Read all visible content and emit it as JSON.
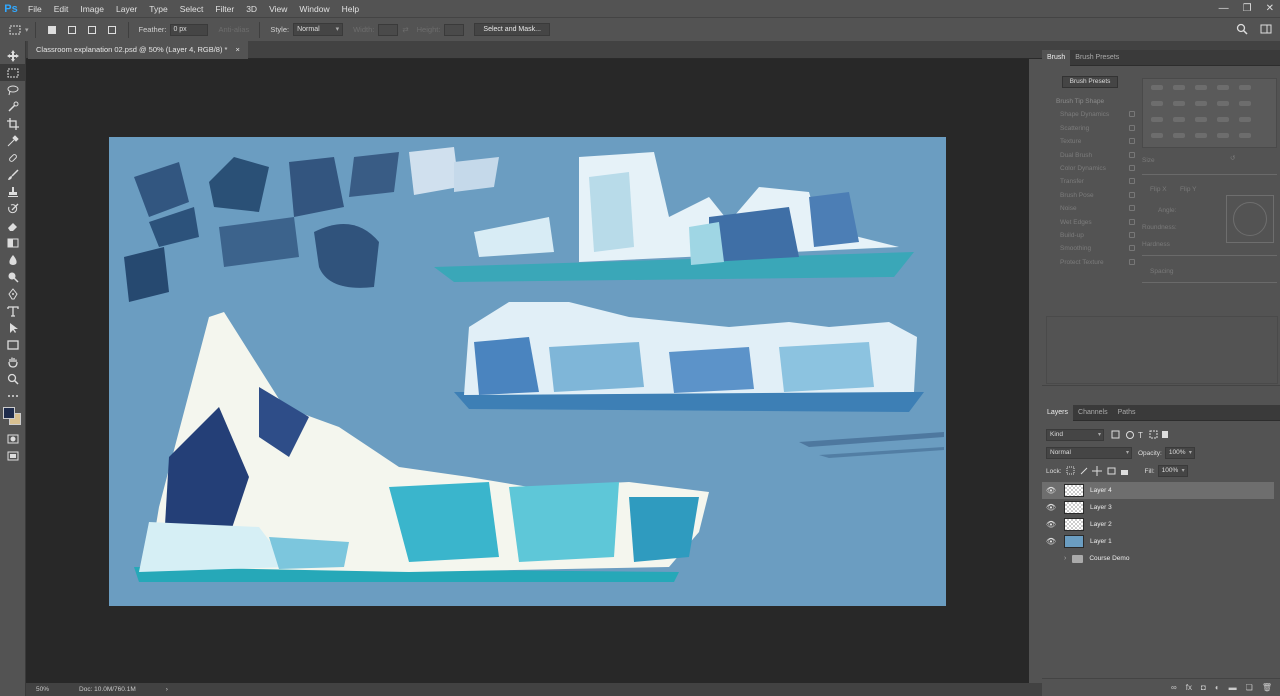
{
  "app": {
    "logo": "Ps"
  },
  "menu": [
    "File",
    "Edit",
    "Image",
    "Layer",
    "Type",
    "Select",
    "Filter",
    "3D",
    "View",
    "Window",
    "Help"
  ],
  "window_controls": {
    "minimize": "—",
    "restore": "❐",
    "close": "✕"
  },
  "options": {
    "feather_label": "Feather:",
    "feather_value": "0 px",
    "antialias_label": "Anti-alias",
    "style_label": "Style:",
    "style_value": "Normal",
    "width_label": "Width:",
    "height_label": "Height:",
    "select_mask_label": "Select and Mask..."
  },
  "document": {
    "tab_title": "Classroom explanation 02.psd @ 50% (Layer 4, RGB/8) *",
    "close": "×"
  },
  "status": {
    "zoom": "50%",
    "doc_info": "Doc: 10.0M/760.1M",
    "arrow": "›"
  },
  "brush_panel": {
    "tabs": [
      "Brush",
      "Brush Presets"
    ],
    "presets_button": "Brush Presets",
    "settings": [
      "Brush Tip Shape",
      "Shape Dynamics",
      "Scattering",
      "Texture",
      "Dual Brush",
      "Color Dynamics",
      "Transfer",
      "Brush Pose",
      "Noise",
      "Wet Edges",
      "Build-up",
      "Smoothing",
      "Protect Texture"
    ],
    "size_label": "Size",
    "flip_x": "Flip X",
    "flip_y": "Flip Y",
    "angle_label": "Angle:",
    "roundness_label": "Roundness:",
    "hardness_label": "Hardness",
    "spacing_label": "Spacing"
  },
  "layers_panel": {
    "tabs": [
      "Layers",
      "Channels",
      "Paths"
    ],
    "filter_kind": "Kind",
    "blend_mode": "Normal",
    "opacity_label": "Opacity:",
    "opacity_value": "100%",
    "lock_label": "Lock:",
    "fill_label": "Fill:",
    "fill_value": "100%",
    "layers": [
      {
        "name": "Layer 4",
        "selected": true
      },
      {
        "name": "Layer 3",
        "selected": false
      },
      {
        "name": "Layer 2",
        "selected": false
      },
      {
        "name": "Layer 1",
        "selected": false
      }
    ],
    "group": "Course Demo",
    "footer_icons": [
      "link-icon",
      "fx-icon",
      "mask-icon",
      "adjustment-icon",
      "folder-icon",
      "new-layer-icon",
      "trash-icon"
    ],
    "footer_fx": "fx"
  },
  "colors": {
    "foreground": "#1f2c4c",
    "background": "#d8c090",
    "canvas": "#6b9dc1",
    "panel": "#535353"
  }
}
